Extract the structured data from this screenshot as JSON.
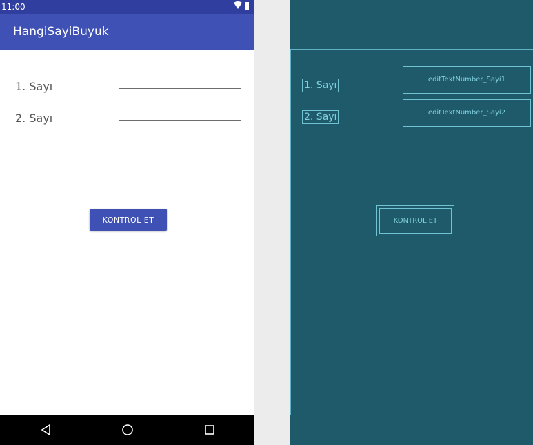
{
  "status_bar": {
    "time": "11:00",
    "icons": [
      "wifi-icon",
      "battery-icon"
    ]
  },
  "app_bar": {
    "title": "HangiSayiBuyuk"
  },
  "form": {
    "label_1": "1. Sayı",
    "label_2": "2. Sayı",
    "input_1_value": "",
    "input_2_value": ""
  },
  "button": {
    "label": "KONTROL ET"
  },
  "nav_bar": {
    "icons": [
      "back-icon",
      "home-icon",
      "recents-icon"
    ]
  },
  "blueprint": {
    "label_1": "1. Sayı",
    "label_2": "2. Sayı",
    "edit_1_id": "editTextNumber_Sayi1",
    "edit_2_id": "editTextNumber_Sayi2",
    "button_label": "KONTROL ET"
  },
  "colors": {
    "status_bar": "#303f9f",
    "app_bar": "#3f51b5",
    "accent_button": "#3f51b5",
    "blueprint_bg": "#1f5a6a",
    "blueprint_line": "#6fc3d2"
  }
}
